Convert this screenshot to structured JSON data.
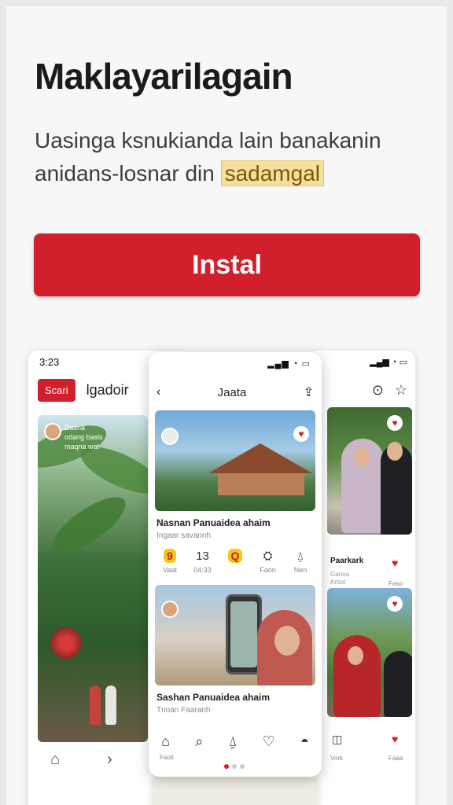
{
  "app": {
    "title": "Maklayarilagain",
    "description_1": "Uasinga ksnukianda lain banakanin",
    "description_2": "anidans-losnar din",
    "description_highlight": "sadamgal",
    "install_label": "Instal"
  },
  "left_screen": {
    "time": "3:23",
    "tag": "Scari",
    "title": "lgadoir",
    "caption": "Dasna\nodang basis\nmaqna wat"
  },
  "center_screen": {
    "title": "Jaata",
    "back_icon": "chevron-left-icon",
    "card1": {
      "title": "Nasnan Panuaidea ahaim",
      "subtitle": "Ingaar savannh",
      "actions": [
        "9",
        "13",
        "Q"
      ],
      "labels": [
        "Vaat",
        "04:33",
        "",
        "Faon",
        "Nen"
      ]
    },
    "card2": {
      "title": "Sashan Panuaidea ahaim",
      "subtitle": "Tnoan Faaranh"
    },
    "nav_label": "Faoit"
  },
  "right_screen": {
    "card1_title": "Paarkark",
    "card1_sub": "Ganoa\nArbot",
    "card1_label": "Faso",
    "card2_label_left": "Vork",
    "card2_label_right": "Faaa"
  }
}
